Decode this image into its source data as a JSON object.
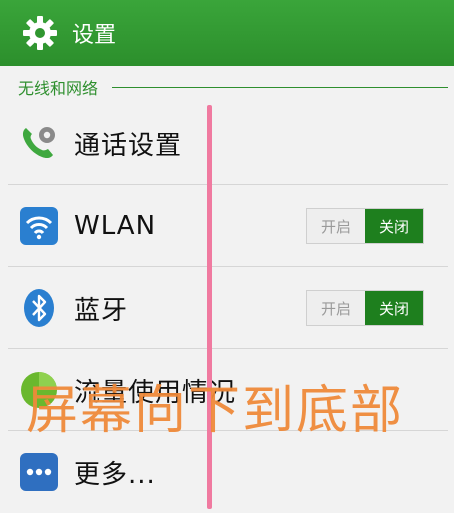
{
  "header": {
    "title": "设置",
    "icon": "gear-icon"
  },
  "section": {
    "title": "无线和网络"
  },
  "items": [
    {
      "label": "通话设置",
      "icon": "phone-gear-icon"
    },
    {
      "label": "WLAN",
      "icon": "wifi-icon",
      "toggle": {
        "on_label": "开启",
        "off_label": "关闭",
        "state": "off"
      }
    },
    {
      "label": "蓝牙",
      "icon": "bluetooth-icon",
      "toggle": {
        "on_label": "开启",
        "off_label": "关闭",
        "state": "off"
      }
    },
    {
      "label": "流量使用情况",
      "icon": "data-usage-icon"
    },
    {
      "label": "更多...",
      "icon": "more-icon"
    }
  ],
  "overlay": {
    "text": "屏幕向下到底部",
    "color": "#ef8a3a"
  },
  "colors": {
    "accent": "#2c8f2c",
    "toggle_active": "#1e7f1e",
    "swipe_line": "#f07aa0"
  }
}
